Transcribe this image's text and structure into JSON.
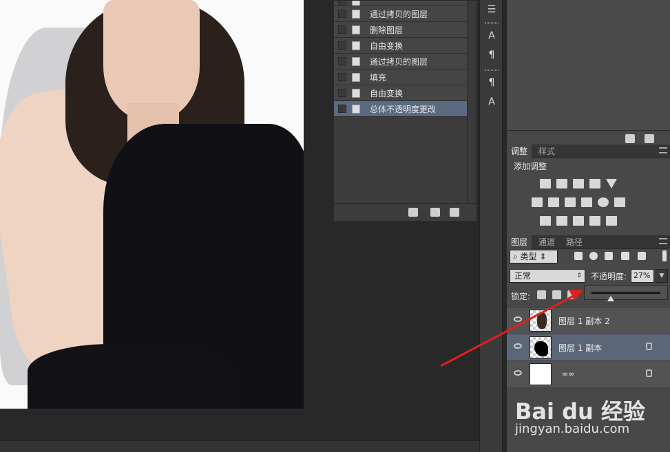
{
  "history": {
    "items": [
      {
        "label": "",
        "selected": false
      },
      {
        "label": "通过拷贝的图层",
        "selected": false
      },
      {
        "label": "删除图层",
        "selected": false
      },
      {
        "label": "自由变换",
        "selected": false
      },
      {
        "label": "通过拷贝的图层",
        "selected": false
      },
      {
        "label": "填充",
        "selected": false
      },
      {
        "label": "自由变换",
        "selected": false
      },
      {
        "label": "总体不透明度更改",
        "selected": true
      }
    ]
  },
  "adjust_panel": {
    "tabs": [
      "调整",
      "样式"
    ],
    "title": "添加调整"
  },
  "layers_panel": {
    "tabs": [
      "图层",
      "通道",
      "路径"
    ],
    "filter_label": "类型",
    "blend_mode": "正常",
    "opacity_label": "不透明度:",
    "opacity_value": "27%",
    "opacity_fraction": 0.27,
    "lock_label": "锁定:",
    "layers": [
      {
        "name": "图层 1 副本 2",
        "selected": false,
        "locked": false
      },
      {
        "name": "图层 1 副本",
        "selected": true,
        "locked": true
      },
      {
        "name": "",
        "selected": false,
        "locked": true
      }
    ]
  },
  "watermark": {
    "brand": "Bai du 经验",
    "url": "jingyan.baidu.com"
  },
  "colors": {
    "selection": "#5b6678",
    "arrow": "#e0201c"
  }
}
